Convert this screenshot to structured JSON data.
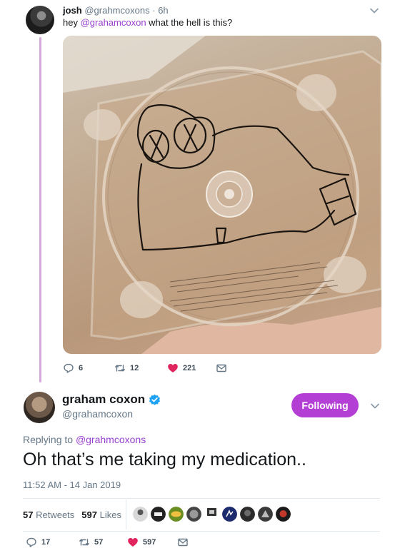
{
  "tweet1": {
    "name": "josh",
    "handle": "@grahmcoxons",
    "dot": "·",
    "time": "6h",
    "text_prefix": "hey ",
    "mention": "@grahamcoxon",
    "text_suffix": " what the hell is this?",
    "actions": {
      "replies": "6",
      "retweets": "12",
      "likes": "221"
    }
  },
  "tweet2": {
    "name": "graham coxon",
    "handle": "@grahamcoxon",
    "follow_label": "Following",
    "replying_prefix": "Replying to ",
    "replying_mention": "@grahmcoxons",
    "text": "Oh that’s me taking my medication..",
    "timestamp": "11:52 AM - 14 Jan 2019",
    "stats": {
      "retweets_count": "57",
      "retweets_label": "Retweets",
      "likes_count": "597",
      "likes_label": "Likes"
    },
    "actions": {
      "replies": "17",
      "retweets": "57",
      "likes": "597"
    }
  },
  "colors": {
    "accent": "#b43fd5",
    "mention": "#9a3fd0",
    "like": "#e0245e",
    "thread_line": "#d6a8dc",
    "verified": "#1da1f2"
  },
  "icons": {
    "reply": "reply-icon",
    "retweet": "retweet-icon",
    "like": "heart-icon",
    "dm": "envelope-icon",
    "caret": "chevron-down-icon",
    "verified": "verified-badge-icon"
  }
}
